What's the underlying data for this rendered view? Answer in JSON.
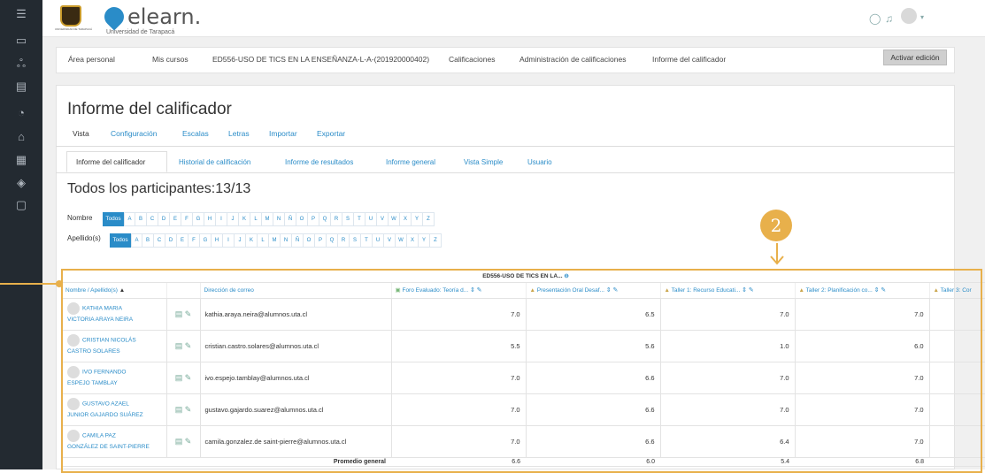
{
  "sidebar": {
    "icons": [
      "menu-icon",
      "folder-icon",
      "users-icon",
      "book-icon",
      "dashboard-icon",
      "home-icon",
      "calendar-icon",
      "graduation-icon",
      "files-icon"
    ],
    "glyphs": [
      "☰",
      "▭",
      "ஃ",
      "▤",
      "◔",
      "⌂",
      "▦",
      "◈",
      "▢"
    ]
  },
  "topbar": {
    "brand": "elearn.",
    "brand_sub": "Universidad de Tarapacá",
    "uni_small": "UNIVERSIDAD DE TARAPACÁ",
    "chat_glyph": "◯",
    "bell_glyph": "♫",
    "caret": "▾"
  },
  "breadcrumb": {
    "items": [
      "Área personal",
      "Mis cursos",
      "ED556-USO DE TICS EN LA ENSEÑANZA-L-A-(201920000402)",
      "Calificaciones",
      "Administración de calificaciones",
      "Informe del calificador"
    ],
    "edit_button": "Activar edición"
  },
  "page": {
    "title": "Informe del calificador",
    "tabs": [
      "Vista",
      "Configuración",
      "Escalas",
      "Letras",
      "Importar",
      "Exportar"
    ],
    "subtabs": [
      "Informe del calificador",
      "Historial de calificación",
      "Informe de resultados",
      "Informe general",
      "Vista Simple",
      "Usuario"
    ],
    "participants": "Todos los participantes:13/13"
  },
  "filters": {
    "nombre_label": "Nombre",
    "apellido_label": "Apellido(s)",
    "all_label": "Todos",
    "letters": [
      "A",
      "B",
      "C",
      "D",
      "E",
      "F",
      "G",
      "H",
      "I",
      "J",
      "K",
      "L",
      "M",
      "N",
      "Ñ",
      "O",
      "P",
      "Q",
      "R",
      "S",
      "T",
      "U",
      "V",
      "W",
      "X",
      "Y",
      "Z"
    ]
  },
  "table": {
    "course_header": "ED556-USO DE TICS EN LA...",
    "course_toggle": "⊖",
    "name_header": "Nombre / Apellido(s)",
    "name_sort": "▲",
    "email_header": "Dirección de correo",
    "columns": [
      "Foro Evaluado: Teoría d...",
      "Presentación Oral Desaf...",
      "Taller 1: Recurso Educati...",
      "Taller 2: Planificación co...",
      "Taller 3: Cor"
    ],
    "col_sort": "⇕",
    "edit_glyph": "✎",
    "rows": [
      {
        "first": "KATHIA MARIA",
        "last": "VICTORIA ARAYA NEIRA",
        "email": "kathia.araya.neira@alumnos.uta.cl",
        "grades": [
          "7.0",
          "6.5",
          "7.0",
          "7.0"
        ]
      },
      {
        "first": "CRISTIAN NICOLÁS",
        "last": "CASTRO SOLARES",
        "email": "cristian.castro.solares@alumnos.uta.cl",
        "grades": [
          "5.5",
          "5.6",
          "1.0",
          "6.0"
        ]
      },
      {
        "first": "IVO FERNANDO",
        "last": "ESPEJO TAMBLAY",
        "email": "ivo.espejo.tamblay@alumnos.uta.cl",
        "grades": [
          "7.0",
          "6.6",
          "7.0",
          "7.0"
        ]
      },
      {
        "first": "GUSTAVO AZAEL",
        "last": "JUNIOR GAJARDO SUÁREZ",
        "email": "gustavo.gajardo.suarez@alumnos.uta.cl",
        "grades": [
          "7.0",
          "6.6",
          "7.0",
          "7.0"
        ]
      },
      {
        "first": "CAMILA PAZ",
        "last": "GONZÁLEZ DE SAINT-PIERRE",
        "email": "camila.gonzalez.de saint-pierre@alumnos.uta.cl",
        "grades": [
          "7.0",
          "6.6",
          "6.4",
          "7.0"
        ]
      }
    ],
    "avg_label": "Promedio general",
    "avg": [
      "6.6",
      "6.0",
      "5.4",
      "6.8"
    ],
    "row_icon": "▤"
  },
  "callout": {
    "number": "2",
    "color": "#e8b04b"
  }
}
